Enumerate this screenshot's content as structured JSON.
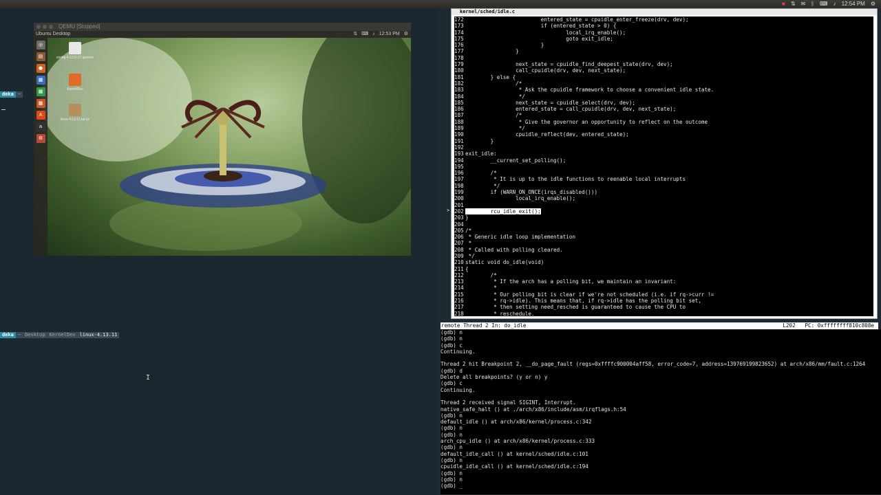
{
  "topbar": {
    "tray_icons": [
      "record-icon",
      "sort-icon",
      "mail-icon",
      "bluetooth-icon",
      "keyboard-icon",
      "volume-icon"
    ],
    "clock": "12:54 PM"
  },
  "left_pane": {
    "session_top": "deka",
    "session_bottom": "deka",
    "segments": [
      "~",
      "Desktop",
      "KernelDev",
      "linux-4.13.11"
    ]
  },
  "qemu": {
    "title": "QEMU [Stopped]",
    "guest_title": "Ubuntu Desktop",
    "guest_clock": "12:53 PM",
    "desktop_icons": [
      {
        "label": "config-4.13.0-37-generic"
      },
      {
        "label": "KernelDev"
      },
      {
        "label": "linux-4.13.11.tar.xz"
      }
    ]
  },
  "code": {
    "file": "kernel/sched/idle.c",
    "lines": [
      {
        "n": "172",
        "t": "                        entered_state = cpuidle_enter_freeze(drv, dev);"
      },
      {
        "n": "173",
        "t": "                        if (entered_state > 0) {"
      },
      {
        "n": "174",
        "t": "                                local_irq_enable();"
      },
      {
        "n": "175",
        "t": "                                goto exit_idle;"
      },
      {
        "n": "176",
        "t": "                        }"
      },
      {
        "n": "177",
        "t": "                }"
      },
      {
        "n": "178",
        "t": ""
      },
      {
        "n": "179",
        "t": "                next_state = cpuidle_find_deepest_state(drv, dev);"
      },
      {
        "n": "180",
        "t": "                call_cpuidle(drv, dev, next_state);"
      },
      {
        "n": "181",
        "t": "        } else {"
      },
      {
        "n": "182",
        "t": "                /*"
      },
      {
        "n": "183",
        "t": "                 * Ask the cpuidle framework to choose a convenient idle state."
      },
      {
        "n": "184",
        "t": "                 */"
      },
      {
        "n": "185",
        "t": "                next_state = cpuidle_select(drv, dev);"
      },
      {
        "n": "186",
        "t": "                entered_state = call_cpuidle(drv, dev, next_state);"
      },
      {
        "n": "187",
        "t": "                /*"
      },
      {
        "n": "188",
        "t": "                 * Give the governor an opportunity to reflect on the outcome"
      },
      {
        "n": "189",
        "t": "                 */"
      },
      {
        "n": "190",
        "t": "                cpuidle_reflect(dev, entered_state);"
      },
      {
        "n": "191",
        "t": "        }"
      },
      {
        "n": "192",
        "t": ""
      },
      {
        "n": "193",
        "t": "exit_idle:"
      },
      {
        "n": "194",
        "t": "        __current_set_polling();"
      },
      {
        "n": "195",
        "t": ""
      },
      {
        "n": "196",
        "t": "        /*"
      },
      {
        "n": "197",
        "t": "         * It is up to the idle functions to reenable local interrupts"
      },
      {
        "n": "198",
        "t": "         */"
      },
      {
        "n": "199",
        "t": "        if (WARN_ON_ONCE(irqs_disabled()))"
      },
      {
        "n": "200",
        "t": "                local_irq_enable();"
      },
      {
        "n": "201",
        "t": ""
      },
      {
        "n": "202",
        "t": "        rcu_idle_exit();",
        "hl": true
      },
      {
        "n": "203",
        "t": "}"
      },
      {
        "n": "204",
        "t": ""
      },
      {
        "n": "205",
        "t": "/*"
      },
      {
        "n": "206",
        "t": " * Generic idle loop implementation"
      },
      {
        "n": "207",
        "t": " *"
      },
      {
        "n": "208",
        "t": " * Called with polling cleared."
      },
      {
        "n": "209",
        "t": " */"
      },
      {
        "n": "210",
        "t": "static void do_idle(void)"
      },
      {
        "n": "211",
        "t": "{"
      },
      {
        "n": "212",
        "t": "        /*"
      },
      {
        "n": "213",
        "t": "         * If the arch has a polling bit, we maintain an invariant:"
      },
      {
        "n": "214",
        "t": "         *"
      },
      {
        "n": "215",
        "t": "         * Our polling bit is clear if we're not scheduled (i.e. if rq->curr !="
      },
      {
        "n": "216",
        "t": "         * rq->idle). This means that, if rq->idle has the polling bit set,"
      },
      {
        "n": "217",
        "t": "         * then setting need_resched is guaranteed to cause the CPU to"
      },
      {
        "n": "218",
        "t": "         * reschedule."
      }
    ]
  },
  "status": {
    "left": "remote Thread 2 In: do_idle",
    "line": "L202",
    "pc": "PC: 0xffffffff810c808e"
  },
  "gdb": [
    "(gdb) n",
    "(gdb) n",
    "(gdb) c",
    "Continuing.",
    "",
    "Thread 2 hit Breakpoint 2, __do_page_fault (regs=0xffffc900004aff58, error_code=7, address=139769199823652) at arch/x86/mm/fault.c:1264",
    "(gdb) d",
    "Delete all breakpoints? (y or n) y",
    "(gdb) c",
    "Continuing.",
    "",
    "Thread 2 received signal SIGINT, Interrupt.",
    "native_safe_halt () at ./arch/x86/include/asm/irqflags.h:54",
    "(gdb) n",
    "default_idle () at arch/x86/kernel/process.c:342",
    "(gdb) n",
    "(gdb) n",
    "arch_cpu_idle () at arch/x86/kernel/process.c:333",
    "(gdb) n",
    "default_idle_call () at kernel/sched/idle.c:101",
    "(gdb) n",
    "cpuidle_idle_call () at kernel/sched/idle.c:194",
    "(gdb) n",
    "(gdb) n",
    "(gdb) _"
  ]
}
